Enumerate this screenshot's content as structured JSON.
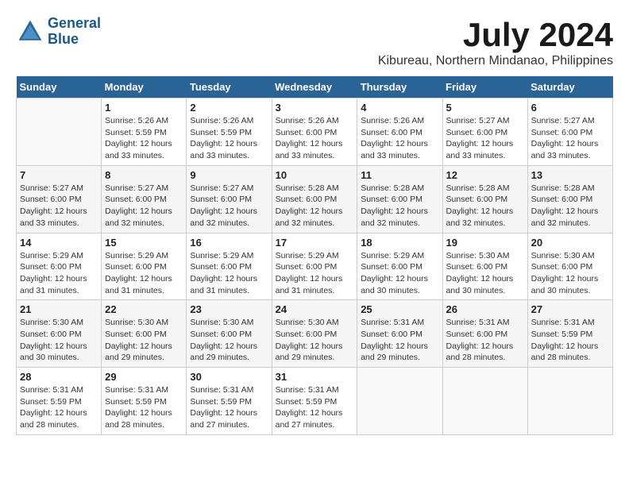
{
  "logo": {
    "line1": "General",
    "line2": "Blue"
  },
  "title": "July 2024",
  "location": "Kibureau, Northern Mindanao, Philippines",
  "days_of_week": [
    "Sunday",
    "Monday",
    "Tuesday",
    "Wednesday",
    "Thursday",
    "Friday",
    "Saturday"
  ],
  "weeks": [
    [
      {
        "day": "",
        "info": ""
      },
      {
        "day": "1",
        "info": "Sunrise: 5:26 AM\nSunset: 5:59 PM\nDaylight: 12 hours\nand 33 minutes."
      },
      {
        "day": "2",
        "info": "Sunrise: 5:26 AM\nSunset: 5:59 PM\nDaylight: 12 hours\nand 33 minutes."
      },
      {
        "day": "3",
        "info": "Sunrise: 5:26 AM\nSunset: 6:00 PM\nDaylight: 12 hours\nand 33 minutes."
      },
      {
        "day": "4",
        "info": "Sunrise: 5:26 AM\nSunset: 6:00 PM\nDaylight: 12 hours\nand 33 minutes."
      },
      {
        "day": "5",
        "info": "Sunrise: 5:27 AM\nSunset: 6:00 PM\nDaylight: 12 hours\nand 33 minutes."
      },
      {
        "day": "6",
        "info": "Sunrise: 5:27 AM\nSunset: 6:00 PM\nDaylight: 12 hours\nand 33 minutes."
      }
    ],
    [
      {
        "day": "7",
        "info": "Sunrise: 5:27 AM\nSunset: 6:00 PM\nDaylight: 12 hours\nand 33 minutes."
      },
      {
        "day": "8",
        "info": "Sunrise: 5:27 AM\nSunset: 6:00 PM\nDaylight: 12 hours\nand 32 minutes."
      },
      {
        "day": "9",
        "info": "Sunrise: 5:27 AM\nSunset: 6:00 PM\nDaylight: 12 hours\nand 32 minutes."
      },
      {
        "day": "10",
        "info": "Sunrise: 5:28 AM\nSunset: 6:00 PM\nDaylight: 12 hours\nand 32 minutes."
      },
      {
        "day": "11",
        "info": "Sunrise: 5:28 AM\nSunset: 6:00 PM\nDaylight: 12 hours\nand 32 minutes."
      },
      {
        "day": "12",
        "info": "Sunrise: 5:28 AM\nSunset: 6:00 PM\nDaylight: 12 hours\nand 32 minutes."
      },
      {
        "day": "13",
        "info": "Sunrise: 5:28 AM\nSunset: 6:00 PM\nDaylight: 12 hours\nand 32 minutes."
      }
    ],
    [
      {
        "day": "14",
        "info": "Sunrise: 5:29 AM\nSunset: 6:00 PM\nDaylight: 12 hours\nand 31 minutes."
      },
      {
        "day": "15",
        "info": "Sunrise: 5:29 AM\nSunset: 6:00 PM\nDaylight: 12 hours\nand 31 minutes."
      },
      {
        "day": "16",
        "info": "Sunrise: 5:29 AM\nSunset: 6:00 PM\nDaylight: 12 hours\nand 31 minutes."
      },
      {
        "day": "17",
        "info": "Sunrise: 5:29 AM\nSunset: 6:00 PM\nDaylight: 12 hours\nand 31 minutes."
      },
      {
        "day": "18",
        "info": "Sunrise: 5:29 AM\nSunset: 6:00 PM\nDaylight: 12 hours\nand 30 minutes."
      },
      {
        "day": "19",
        "info": "Sunrise: 5:30 AM\nSunset: 6:00 PM\nDaylight: 12 hours\nand 30 minutes."
      },
      {
        "day": "20",
        "info": "Sunrise: 5:30 AM\nSunset: 6:00 PM\nDaylight: 12 hours\nand 30 minutes."
      }
    ],
    [
      {
        "day": "21",
        "info": "Sunrise: 5:30 AM\nSunset: 6:00 PM\nDaylight: 12 hours\nand 30 minutes."
      },
      {
        "day": "22",
        "info": "Sunrise: 5:30 AM\nSunset: 6:00 PM\nDaylight: 12 hours\nand 29 minutes."
      },
      {
        "day": "23",
        "info": "Sunrise: 5:30 AM\nSunset: 6:00 PM\nDaylight: 12 hours\nand 29 minutes."
      },
      {
        "day": "24",
        "info": "Sunrise: 5:30 AM\nSunset: 6:00 PM\nDaylight: 12 hours\nand 29 minutes."
      },
      {
        "day": "25",
        "info": "Sunrise: 5:31 AM\nSunset: 6:00 PM\nDaylight: 12 hours\nand 29 minutes."
      },
      {
        "day": "26",
        "info": "Sunrise: 5:31 AM\nSunset: 6:00 PM\nDaylight: 12 hours\nand 28 minutes."
      },
      {
        "day": "27",
        "info": "Sunrise: 5:31 AM\nSunset: 5:59 PM\nDaylight: 12 hours\nand 28 minutes."
      }
    ],
    [
      {
        "day": "28",
        "info": "Sunrise: 5:31 AM\nSunset: 5:59 PM\nDaylight: 12 hours\nand 28 minutes."
      },
      {
        "day": "29",
        "info": "Sunrise: 5:31 AM\nSunset: 5:59 PM\nDaylight: 12 hours\nand 28 minutes."
      },
      {
        "day": "30",
        "info": "Sunrise: 5:31 AM\nSunset: 5:59 PM\nDaylight: 12 hours\nand 27 minutes."
      },
      {
        "day": "31",
        "info": "Sunrise: 5:31 AM\nSunset: 5:59 PM\nDaylight: 12 hours\nand 27 minutes."
      },
      {
        "day": "",
        "info": ""
      },
      {
        "day": "",
        "info": ""
      },
      {
        "day": "",
        "info": ""
      }
    ]
  ]
}
